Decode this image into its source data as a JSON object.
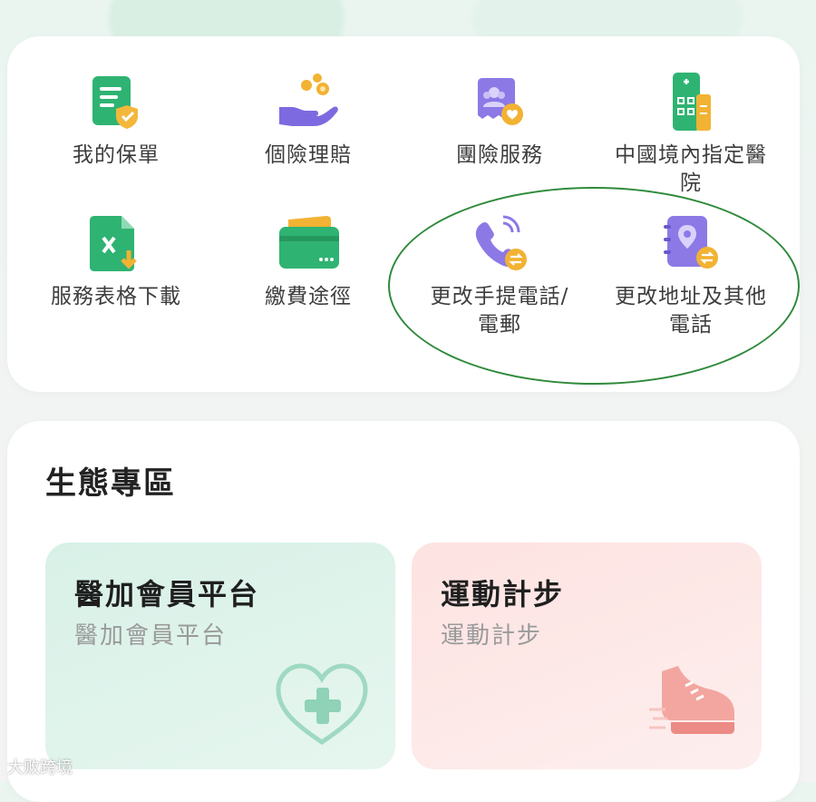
{
  "services": {
    "items": [
      {
        "label": "我的保單",
        "icon": "policy-document-icon"
      },
      {
        "label": "個險理賠",
        "icon": "claim-hand-coins-icon"
      },
      {
        "label": "團險服務",
        "icon": "group-insurance-icon"
      },
      {
        "label": "中國境內指定醫院",
        "icon": "hospital-building-icon"
      },
      {
        "label": "服務表格下載",
        "icon": "excel-download-icon"
      },
      {
        "label": "繳費途徑",
        "icon": "payment-card-icon"
      },
      {
        "label": "更改手提電話/電郵",
        "icon": "change-phone-icon"
      },
      {
        "label": "更改地址及其他電話",
        "icon": "change-address-icon"
      }
    ]
  },
  "ecosystem": {
    "title": "生態專區",
    "cards": [
      {
        "title": "醫加會員平台",
        "subtitle": "醫加會員平台",
        "icon": "heart-plus-icon"
      },
      {
        "title": "運動計步",
        "subtitle": "運動計步",
        "icon": "sneaker-icon"
      }
    ]
  },
  "watermark": "大败跨境",
  "colors": {
    "green": "#2fa36b",
    "purple": "#7d6ae0",
    "gold": "#f2b233",
    "highlight": "#2f8a3b"
  }
}
